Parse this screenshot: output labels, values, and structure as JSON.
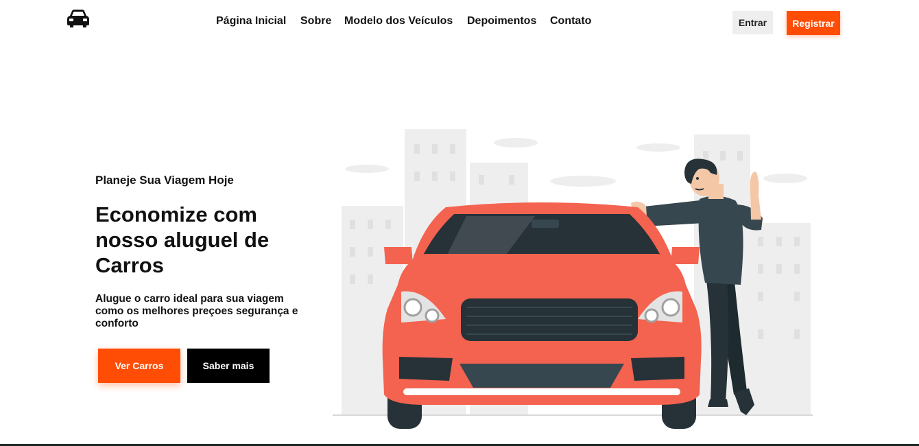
{
  "header": {
    "logo_icon": "car-icon",
    "nav": [
      {
        "label": "Página Inicial"
      },
      {
        "label": "Sobre"
      },
      {
        "label": "Modelo dos Veículos"
      },
      {
        "label": "Depoimentos"
      },
      {
        "label": "Contato"
      }
    ],
    "login_label": "Entrar",
    "register_label": "Registrar"
  },
  "hero": {
    "subtitle": "Planeje Sua Viagem Hoje",
    "title": "Economize com nosso aluguel de Carros",
    "description": "Alugue o carro ideal para sua viagem como os melhores preçoes segurança e conforto",
    "primary_cta": "Ver Carros",
    "secondary_cta": "Saber mais",
    "illustration": "man-leaning-on-red-car-illustration"
  },
  "colors": {
    "accent": "#ff4d05",
    "dark": "#000000",
    "car_red": "#f4634f",
    "car_dark": "#263238"
  }
}
